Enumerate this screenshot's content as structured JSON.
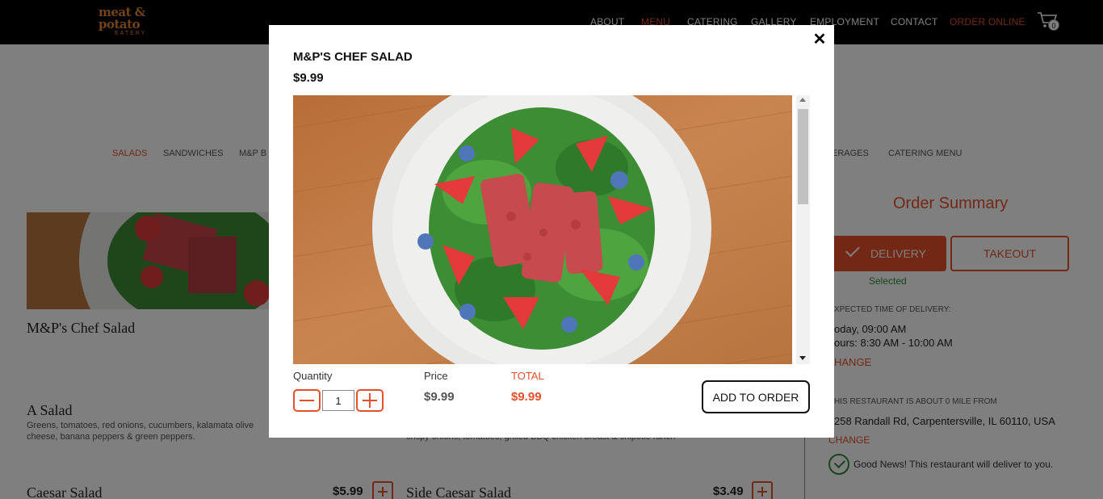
{
  "brand": {
    "logo_line1": "meat &",
    "logo_line2": "potato",
    "logo_line3": "EATERY"
  },
  "nav": {
    "items": [
      {
        "label": "ABOUT"
      },
      {
        "label": "MENU",
        "active": true
      },
      {
        "label": "CATERING"
      },
      {
        "label": "GALLERY"
      },
      {
        "label": "EMPLOYMENT"
      },
      {
        "label": "CONTACT"
      },
      {
        "label": "ORDER ONLINE",
        "highlight": true
      }
    ],
    "cart_count": "0"
  },
  "categories": {
    "items": [
      {
        "label": "SALADS",
        "active": true
      },
      {
        "label": "SANDWICHES"
      },
      {
        "label": "M&P B"
      },
      {
        "label": "ERAGES"
      },
      {
        "label": "CATERING MENU"
      }
    ]
  },
  "menu": {
    "items": [
      {
        "name": "M&P's Chef Salad"
      },
      {
        "name": "A Salad",
        "desc_line1": "Greens, tomatoes, red onions, cucumbers, kalamata olive",
        "desc_line2": "cheese, banana peppers & green peppers."
      },
      {
        "name": "Caesar Salad",
        "price": "$5.99"
      },
      {
        "name": "Side Caesar Salad",
        "price": "$3.49"
      }
    ],
    "partial_desc": "crispy onions, tomatoes, grilled BBQ chicken breast & chipotle ranch"
  },
  "order_summary": {
    "title": "Order Summary",
    "delivery_label": "DELIVERY",
    "takeout_label": "TAKEOUT",
    "selected_text": "Selected",
    "expected_label": "XPECTED TIME OF DELIVERY:",
    "time_line1": "oday, 09:00 AM",
    "time_line2": "ours: 8:30 AM - 10:00 AM",
    "change1": "HANGE",
    "distance_label": "HIS RESTAURANT IS ABOUT 0 MILE FROM",
    "address": "258 Randall Rd, Carpentersville, IL 60110, USA",
    "change2": "CHANGE",
    "good_news": "Good News! This restaurant will deliver to you."
  },
  "modal": {
    "title": "M&P'S CHEF SALAD",
    "price": "$9.99",
    "close_glyph": "✕",
    "quantity_label": "Quantity",
    "quantity_value": "1",
    "price_label": "Price",
    "price_value": "$9.99",
    "total_label": "TOTAL",
    "total_value": "$9.99",
    "add_to_order_label": "ADD TO ORDER"
  },
  "colors": {
    "accent": "#e5502a",
    "success": "#2e8b3a",
    "topbar": "#000000"
  }
}
